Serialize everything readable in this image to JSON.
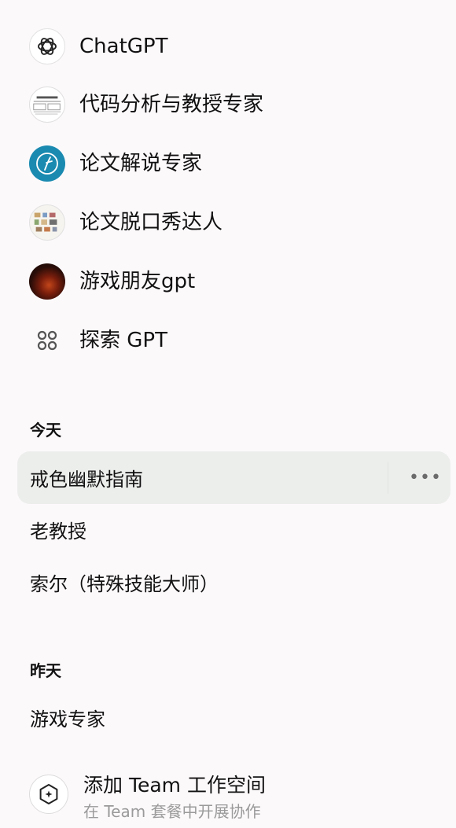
{
  "gpts": [
    {
      "label": "ChatGPT",
      "icon": "openai-logo-icon"
    },
    {
      "label": "代码分析与教授专家",
      "icon": "code-expert-avatar"
    },
    {
      "label": "论文解说专家",
      "icon": "paper-explainer-avatar"
    },
    {
      "label": "论文脱口秀达人",
      "icon": "paper-standup-avatar"
    },
    {
      "label": "游戏朋友gpt",
      "icon": "game-friend-avatar"
    },
    {
      "label": "探索 GPT",
      "icon": "explore-grid-icon"
    }
  ],
  "history": {
    "today_label": "今天",
    "today": [
      {
        "label": "戒色幽默指南",
        "more": "•••"
      },
      {
        "label": "老教授"
      },
      {
        "label": "索尔（特殊技能大师）"
      }
    ],
    "yesterday_label": "昨天",
    "yesterday": [
      {
        "label": "游戏专家"
      }
    ]
  },
  "team": {
    "title": "添加 Team 工作空间",
    "subtitle": "在 Team 套餐中开展协作",
    "icon": "team-add-icon"
  },
  "colors": {
    "background": "#fcf9fb",
    "active_item": "#eceeec",
    "paper_avatar": "#1a8ab0",
    "muted_text": "#9a9a9a"
  }
}
